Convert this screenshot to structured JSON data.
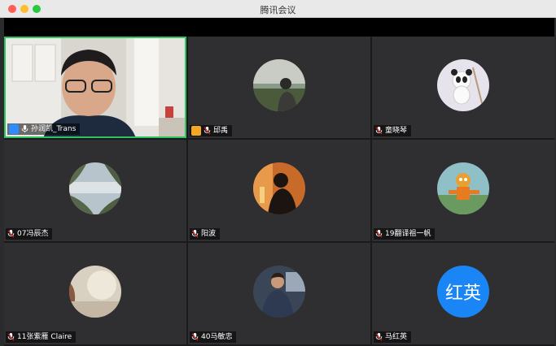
{
  "app": {
    "title": "腾讯会议"
  },
  "participants": [
    {
      "name": "孙润凯_Trans",
      "type": "video"
    },
    {
      "name": "邱禹",
      "type": "avatar"
    },
    {
      "name": "童晓琴",
      "type": "avatar"
    },
    {
      "name": "07冯辰杰",
      "type": "avatar"
    },
    {
      "name": "阳波",
      "type": "avatar"
    },
    {
      "name": "19翻译祖一帆",
      "type": "avatar"
    },
    {
      "name": "11张紫雁 Claire",
      "type": "avatar"
    },
    {
      "name": "40马敏忠",
      "type": "avatar"
    },
    {
      "name": "马红英",
      "type": "initials",
      "initials": "红英"
    }
  ],
  "colors": {
    "active_border": "#2ec562",
    "initials_bg": "#1a86f5",
    "host_badge": "#2d8cff",
    "cohost_badge": "#f5a623"
  }
}
